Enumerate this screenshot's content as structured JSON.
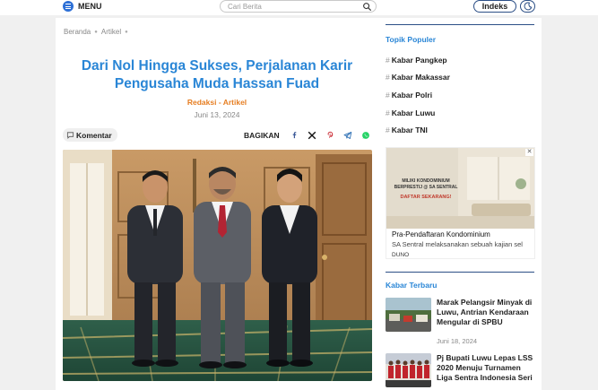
{
  "header": {
    "menu_label": "MENU",
    "search_placeholder": "Cari Berita",
    "indeks_label": "Indeks"
  },
  "breadcrumb": [
    "Beranda",
    "Artikel"
  ],
  "article": {
    "title": "Dari Nol Hingga Sukses, Perjalanan Karir Pengusaha Muda Hassan Fuad",
    "author": "Redaksi",
    "separator": "-",
    "category": "Artikel",
    "date": "Juni 13, 2024",
    "comment_label": "Komentar",
    "share_label": "BAGIKAN",
    "share_icons": [
      "facebook-icon",
      "x-icon",
      "pinterest-icon",
      "telegram-icon",
      "whatsapp-icon"
    ]
  },
  "sidebar": {
    "topik_title": "Topik Populer",
    "topik_hash": "#",
    "topik_items": [
      "Kabar Pangkep",
      "Kabar Makassar",
      "Kabar Polri",
      "Kabar Luwu",
      "Kabar TNI"
    ],
    "ad": {
      "banner_line1": "MILIKI KONDOMINIUM",
      "banner_line2": "BERPRESTIJ @ SA SENTRAL",
      "banner_line3": "DAFTAR SEKARANG!",
      "title": "Pra-Pendaftaran Kondominium",
      "description": "SA Sentral melaksanakan sebuah kajian sel",
      "cta": "DUNO"
    },
    "terbaru_title": "Kabar Terbaru",
    "latest": [
      {
        "title": "Marak Pelangsir Minyak di Luwu, Antrian Kendaraan Mengular di SPBU",
        "date": "Juni 18, 2024"
      },
      {
        "title": "Pj Bupati Luwu Lepas LSS 2020 Menuju Turnamen Liga Sentra Indonesia Seri",
        "date": ""
      }
    ]
  },
  "colors": {
    "accent_blue": "#2a86d6",
    "author_orange": "#e67e22",
    "navy": "#2c4f86"
  }
}
